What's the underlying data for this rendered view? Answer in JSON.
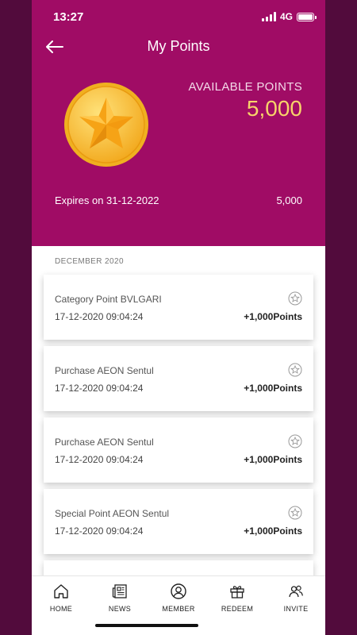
{
  "status_bar": {
    "time": "13:27",
    "network": "4G"
  },
  "header": {
    "title": "My Points",
    "available_label": "AVAILABLE POINTS",
    "available_value": "5,000",
    "expires_text": "Expires on 31-12-2022",
    "expires_value": "5,000"
  },
  "history": {
    "month": "DECEMBER 2020",
    "items": [
      {
        "name": "Category Point BVLGARI",
        "date": "17-12-2020 09:04:24",
        "points": "+1,000Points"
      },
      {
        "name": "Purchase AEON Sentul",
        "date": "17-12-2020 09:04:24",
        "points": "+1,000Points"
      },
      {
        "name": "Purchase AEON Sentul",
        "date": "17-12-2020 09:04:24",
        "points": "+1,000Points"
      },
      {
        "name": "Special Point AEON Sentul",
        "date": "17-12-2020 09:04:24",
        "points": "+1,000Points"
      }
    ]
  },
  "tabbar": {
    "items": [
      {
        "label": "HOME",
        "icon": "home-icon"
      },
      {
        "label": "NEWS",
        "icon": "news-icon"
      },
      {
        "label": "MEMBER",
        "icon": "member-icon"
      },
      {
        "label": "REDEEM",
        "icon": "gift-icon"
      },
      {
        "label": "INVITE",
        "icon": "invite-icon"
      }
    ]
  },
  "colors": {
    "header_bg": "#a00c65",
    "outer_bg": "#520b3c",
    "points_accent": "#f7d36a",
    "coin_gold": "#f5b820"
  }
}
